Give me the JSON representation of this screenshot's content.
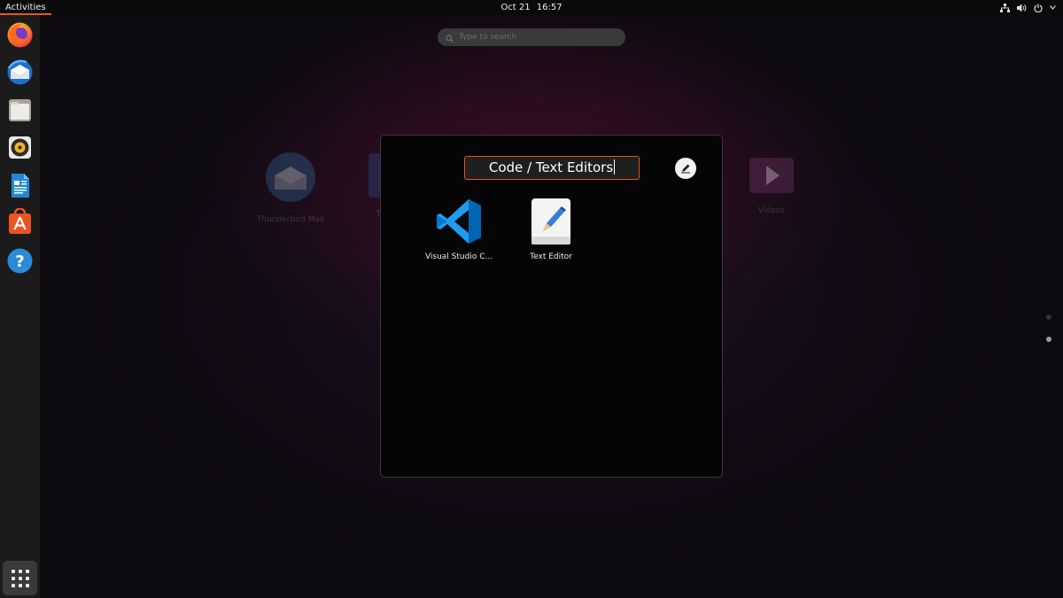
{
  "topbar": {
    "activities": "Activities",
    "date": "Oct 21",
    "time": "16:57",
    "tray_icons": [
      "network-icon",
      "volume-icon",
      "power-icon",
      "chevron-down-icon"
    ]
  },
  "dock": {
    "items": [
      {
        "name": "Firefox",
        "icon": "firefox-icon"
      },
      {
        "name": "Thunderbird Mail",
        "icon": "thunderbird-icon"
      },
      {
        "name": "Files",
        "icon": "files-icon"
      },
      {
        "name": "Rhythmbox",
        "icon": "rhythmbox-icon"
      },
      {
        "name": "LibreOffice Writer",
        "icon": "writer-icon"
      },
      {
        "name": "Ubuntu Software",
        "icon": "software-icon"
      },
      {
        "name": "Help",
        "icon": "help-icon"
      }
    ],
    "show_apps_icon": "grid-icon"
  },
  "search": {
    "placeholder": "Type to search",
    "value": ""
  },
  "background_apps": [
    {
      "label": "Thunderbird Mail",
      "icon": "thunderbird-icon"
    },
    {
      "label": "T",
      "icon": "app-icon"
    },
    {
      "label": "Videos",
      "icon": "videos-icon"
    }
  ],
  "folder": {
    "name": "Code / Text Editors",
    "rename_icon": "pencil-icon",
    "apps": [
      {
        "label": "Visual Studio C...",
        "icon": "vscode-icon"
      },
      {
        "label": "Text Editor",
        "icon": "text-editor-icon"
      }
    ]
  },
  "colors": {
    "accent": "#e95420",
    "topbar": "#0a0a0a",
    "dock": "#1b1b1b",
    "folder_bg": "#050505"
  }
}
